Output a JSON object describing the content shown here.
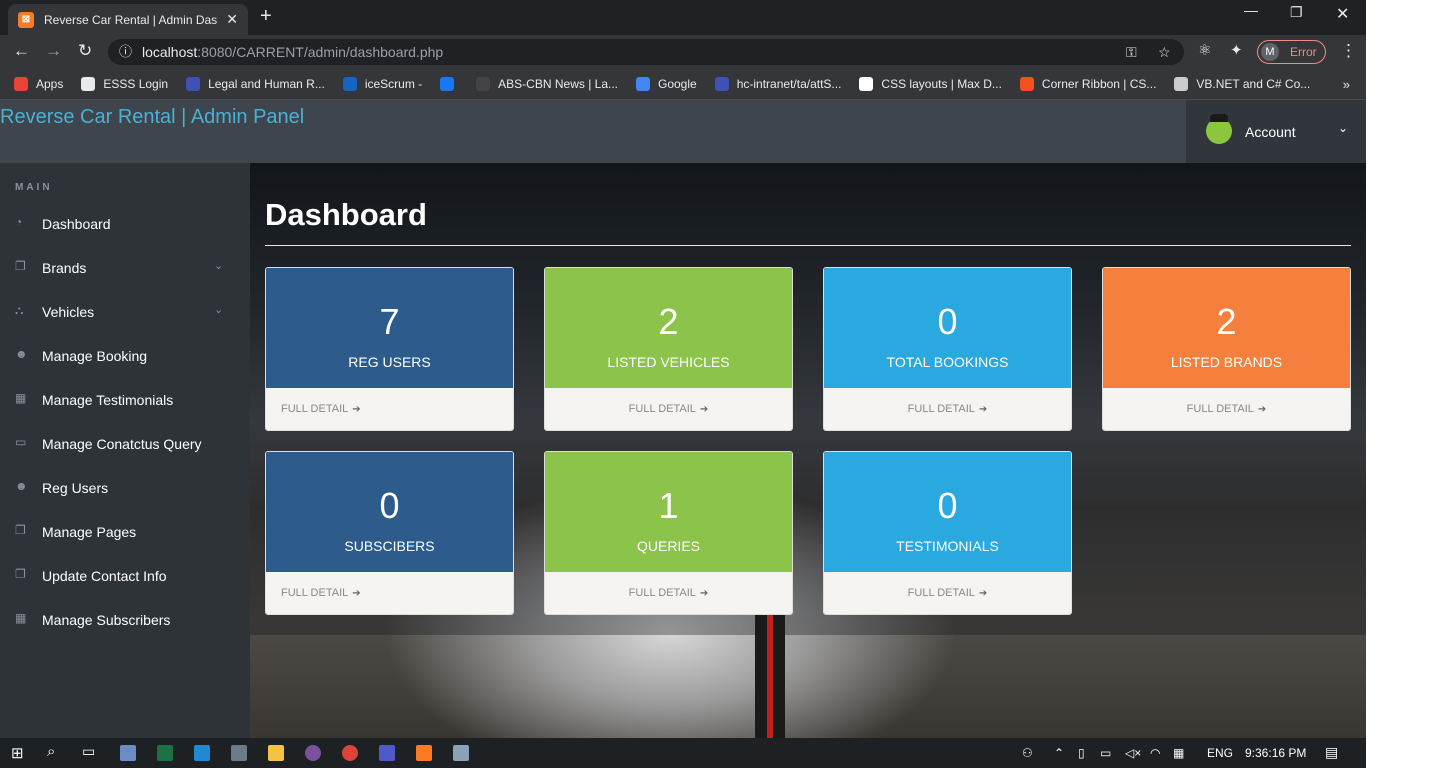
{
  "browser": {
    "tab_title": "Reverse Car Rental | Admin Dash",
    "tab_favicon": "xampp",
    "url_host": "localhost",
    "url_path": ":8080/CARRENT/admin/dashboard.php",
    "profile_initial": "M",
    "profile_status": "Error",
    "bookmarks": [
      "Apps",
      "ESSS Login",
      "Legal and Human R...",
      "iceScrum -",
      "",
      "ABS-CBN News | La...",
      "Google",
      "hc-intranet/ta/attS...",
      "CSS layouts | Max D...",
      "Corner Ribbon | CS...",
      "VB.NET and C# Co..."
    ],
    "bookmark_colors": [
      "#ea4335",
      "#e8eaed",
      "#3f51b5",
      "#1565c0",
      "#1877f2",
      "#444",
      "#4285f4",
      "#3f51b5",
      "#fff",
      "#f4511e",
      "#ccc"
    ]
  },
  "app": {
    "brand": "Reverse Car Rental | Admin Panel",
    "account_label": "Account",
    "sidebar_heading": "MAIN",
    "nav": [
      {
        "label": "Dashboard",
        "icon": "dashboard-icon",
        "submenu": false
      },
      {
        "label": "Brands",
        "icon": "files-icon",
        "submenu": true
      },
      {
        "label": "Vehicles",
        "icon": "sitemap-icon",
        "submenu": true
      },
      {
        "label": "Manage Booking",
        "icon": "users-icon",
        "submenu": false
      },
      {
        "label": "Manage Testimonials",
        "icon": "table-icon",
        "submenu": false
      },
      {
        "label": "Manage Conatctus Query",
        "icon": "desktop-icon",
        "submenu": false
      },
      {
        "label": "Reg Users",
        "icon": "users-icon",
        "submenu": false
      },
      {
        "label": "Manage Pages",
        "icon": "files-icon",
        "submenu": false
      },
      {
        "label": "Update Contact Info",
        "icon": "files-icon",
        "submenu": false
      },
      {
        "label": "Manage Subscribers",
        "icon": "table-icon",
        "submenu": false
      }
    ],
    "page_title": "Dashboard",
    "detail_label": "FULL DETAIL",
    "cards": [
      {
        "value": "7",
        "label": "REG USERS",
        "color": "#2c5b8c"
      },
      {
        "value": "2",
        "label": "LISTED VEHICLES",
        "color": "#8cc34a"
      },
      {
        "value": "0",
        "label": "TOTAL BOOKINGS",
        "color": "#29a9df"
      },
      {
        "value": "2",
        "label": "LISTED BRANDS",
        "color": "#f57f3d"
      },
      {
        "value": "0",
        "label": "SUBSCIBERS",
        "color": "#2c5b8c"
      },
      {
        "value": "1",
        "label": "QUERIES",
        "color": "#8cc34a"
      },
      {
        "value": "0",
        "label": "TESTIMONIALS",
        "color": "#29a9df"
      }
    ]
  },
  "taskbar": {
    "language": "ENG",
    "time": "9:36:16 PM"
  }
}
